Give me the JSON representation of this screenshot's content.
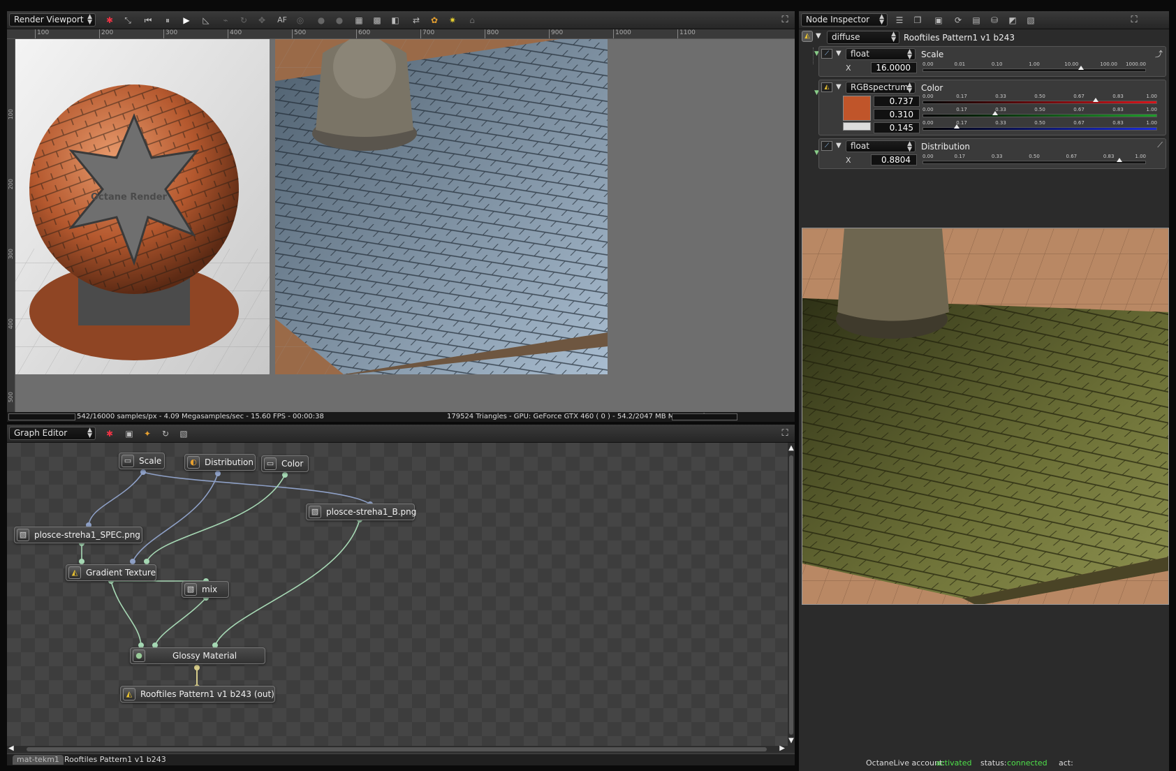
{
  "viewport": {
    "mode": "Render Viewport",
    "ruler_h": [
      "100",
      "200",
      "300",
      "400",
      "500",
      "600",
      "700",
      "800",
      "900",
      "1000",
      "1100"
    ],
    "ruler_v": [
      "100",
      "200",
      "300",
      "400",
      "500"
    ],
    "toolbar_icons": [
      "reset-icon",
      "fit-icon",
      "restart-icon",
      "pause-icon",
      "play-icon",
      "ruler-icon",
      "af-lock-icon",
      "rotate-icon",
      "pan-icon",
      "af-label",
      "focus-icon",
      "eye-icon",
      "zoom-icon",
      "region-icon",
      "select-icon",
      "split-icon",
      "export-icon",
      "palette-icon",
      "light-icon",
      "lock-icon"
    ],
    "af_label": "AF",
    "preview_text": "Octane Render",
    "status_left": "542/16000 samples/px - 4.09 Megasamples/sec - 15.60 FPS - 00:00:38",
    "status_right": "179524 Triangles - GPU: GeForce GTX 460 ( 0 ) - 54.2/2047 MB Mem Used"
  },
  "graph": {
    "mode": "Graph Editor",
    "nodes": [
      {
        "id": "scale",
        "label": "Scale"
      },
      {
        "id": "distribution",
        "label": "Distribution"
      },
      {
        "id": "color",
        "label": "Color"
      },
      {
        "id": "bmap",
        "label": "plosce-streha1_B.png"
      },
      {
        "id": "spec",
        "label": "plosce-streha1_SPEC.png"
      },
      {
        "id": "gradient",
        "label": "Gradient Texture"
      },
      {
        "id": "mix",
        "label": "mix"
      },
      {
        "id": "glossy",
        "label": "Glossy Material"
      },
      {
        "id": "out",
        "label": "Rooftiles Pattern1 v1 b243 (out)"
      }
    ],
    "tabs": [
      "mat-tekm1",
      "Rooftiles Pattern1 v1 b243"
    ]
  },
  "inspector": {
    "mode": "Node Inspector",
    "pin_type": "diffuse",
    "node_name": "Rooftiles Pattern1 v1 b243",
    "params": [
      {
        "type": "float",
        "name": "Scale",
        "axis": "X",
        "value": "16.0000",
        "ticks": [
          "0.00",
          "0.01",
          "0.10",
          "1.00",
          "10.00",
          "100.00",
          "1000.00"
        ],
        "level": 0.71
      },
      {
        "type": "RGBspectrum",
        "name": "Color",
        "swatch": "#c0552a",
        "channels": [
          {
            "value": "0.737",
            "ticks": [
              "0.00",
              "0.17",
              "0.33",
              "0.50",
              "0.67",
              "0.83",
              "1.00"
            ],
            "level": 0.737,
            "color": "#d8141a"
          },
          {
            "value": "0.310",
            "ticks": [
              "0.00",
              "0.17",
              "0.33",
              "0.50",
              "0.67",
              "0.83",
              "1.00"
            ],
            "level": 0.31,
            "color": "#1e9d2a"
          },
          {
            "value": "0.145",
            "ticks": [
              "0.00",
              "0.17",
              "0.33",
              "0.50",
              "0.67",
              "0.83",
              "1.00"
            ],
            "level": 0.145,
            "color": "#1a2bd8"
          }
        ]
      },
      {
        "type": "float",
        "name": "Distribution",
        "axis": "X",
        "value": "0.8804",
        "ticks": [
          "0.00",
          "0.17",
          "0.33",
          "0.50",
          "0.67",
          "0.83",
          "1.00"
        ],
        "level": 0.8804
      }
    ],
    "footer": {
      "account_label": "OctaneLive account:",
      "account_value": "activated",
      "status_label": "status:",
      "status_value": "connected",
      "act_label": "act:"
    }
  }
}
